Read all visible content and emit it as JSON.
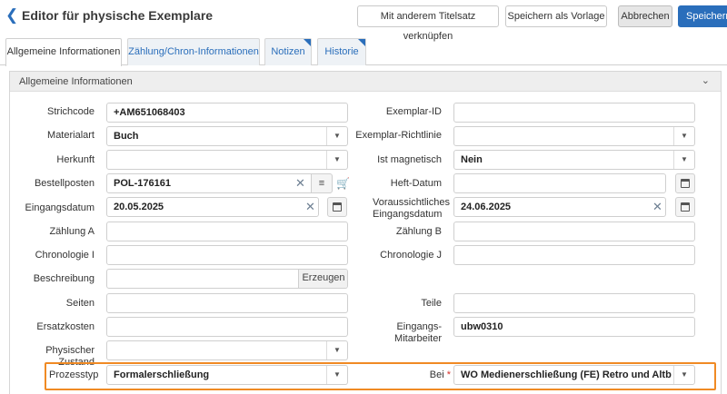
{
  "header": {
    "title": "Editor für physische Exemplare",
    "buttons": {
      "link": "Mit anderem Titelsatz verknüpfen",
      "template": "Speichern als Vorlage",
      "cancel": "Abbrechen",
      "save": "Speichern"
    }
  },
  "tabs": [
    {
      "label": "Allgemeine Informationen",
      "active": true
    },
    {
      "label": "Zählung/Chron-Informationen",
      "active": false
    },
    {
      "label": "Notizen",
      "active": false
    },
    {
      "label": "Historie",
      "active": false
    }
  ],
  "section": {
    "title": "Allgemeine Informationen"
  },
  "form": {
    "strichcode": {
      "label": "Strichcode",
      "value": "+AM651068403"
    },
    "exemplar_id": {
      "label": "Exemplar-ID",
      "value": ""
    },
    "materialart": {
      "label": "Materialart",
      "value": "Buch"
    },
    "exemplar_richtlinie": {
      "label": "Exemplar-Richtlinie",
      "value": ""
    },
    "herkunft": {
      "label": "Herkunft",
      "value": ""
    },
    "ist_magnetisch": {
      "label": "Ist magnetisch",
      "value": "Nein"
    },
    "bestellposten": {
      "label": "Bestellposten",
      "value": "POL-176161"
    },
    "heft_datum": {
      "label": "Heft-Datum",
      "value": ""
    },
    "eingangsdatum": {
      "label": "Eingangsdatum",
      "value": "20.05.2025"
    },
    "vorauss_eingang": {
      "label_line1": "Voraussichtliches",
      "label_line2": "Eingangsdatum",
      "value": "24.06.2025"
    },
    "zaehlung_a": {
      "label": "Zählung A",
      "value": ""
    },
    "zaehlung_b": {
      "label": "Zählung B",
      "value": ""
    },
    "chronologie_i": {
      "label": "Chronologie I",
      "value": ""
    },
    "chronologie_j": {
      "label": "Chronologie J",
      "value": ""
    },
    "beschreibung": {
      "label": "Beschreibung",
      "value": "",
      "button": "Erzeugen"
    },
    "seiten": {
      "label": "Seiten",
      "value": ""
    },
    "teile": {
      "label": "Teile",
      "value": ""
    },
    "ersatzkosten": {
      "label": "Ersatzkosten",
      "value": ""
    },
    "eingangs_mitarbeiter": {
      "label": "Eingangs-Mitarbeiter",
      "value": "ubw0310"
    },
    "physischer_zustand": {
      "label": "Physischer Zustand",
      "value": ""
    },
    "prozesstyp": {
      "label": "Prozesstyp",
      "value": "Formalerschließung"
    },
    "bei": {
      "label": "Bei",
      "required_mark": "*",
      "value": "WO Medienerschließung (FE) Retro und Altbestand AF"
    }
  },
  "colors": {
    "accent": "#2a6ebb",
    "highlight": "#f08a24",
    "required": "#d6312b"
  }
}
